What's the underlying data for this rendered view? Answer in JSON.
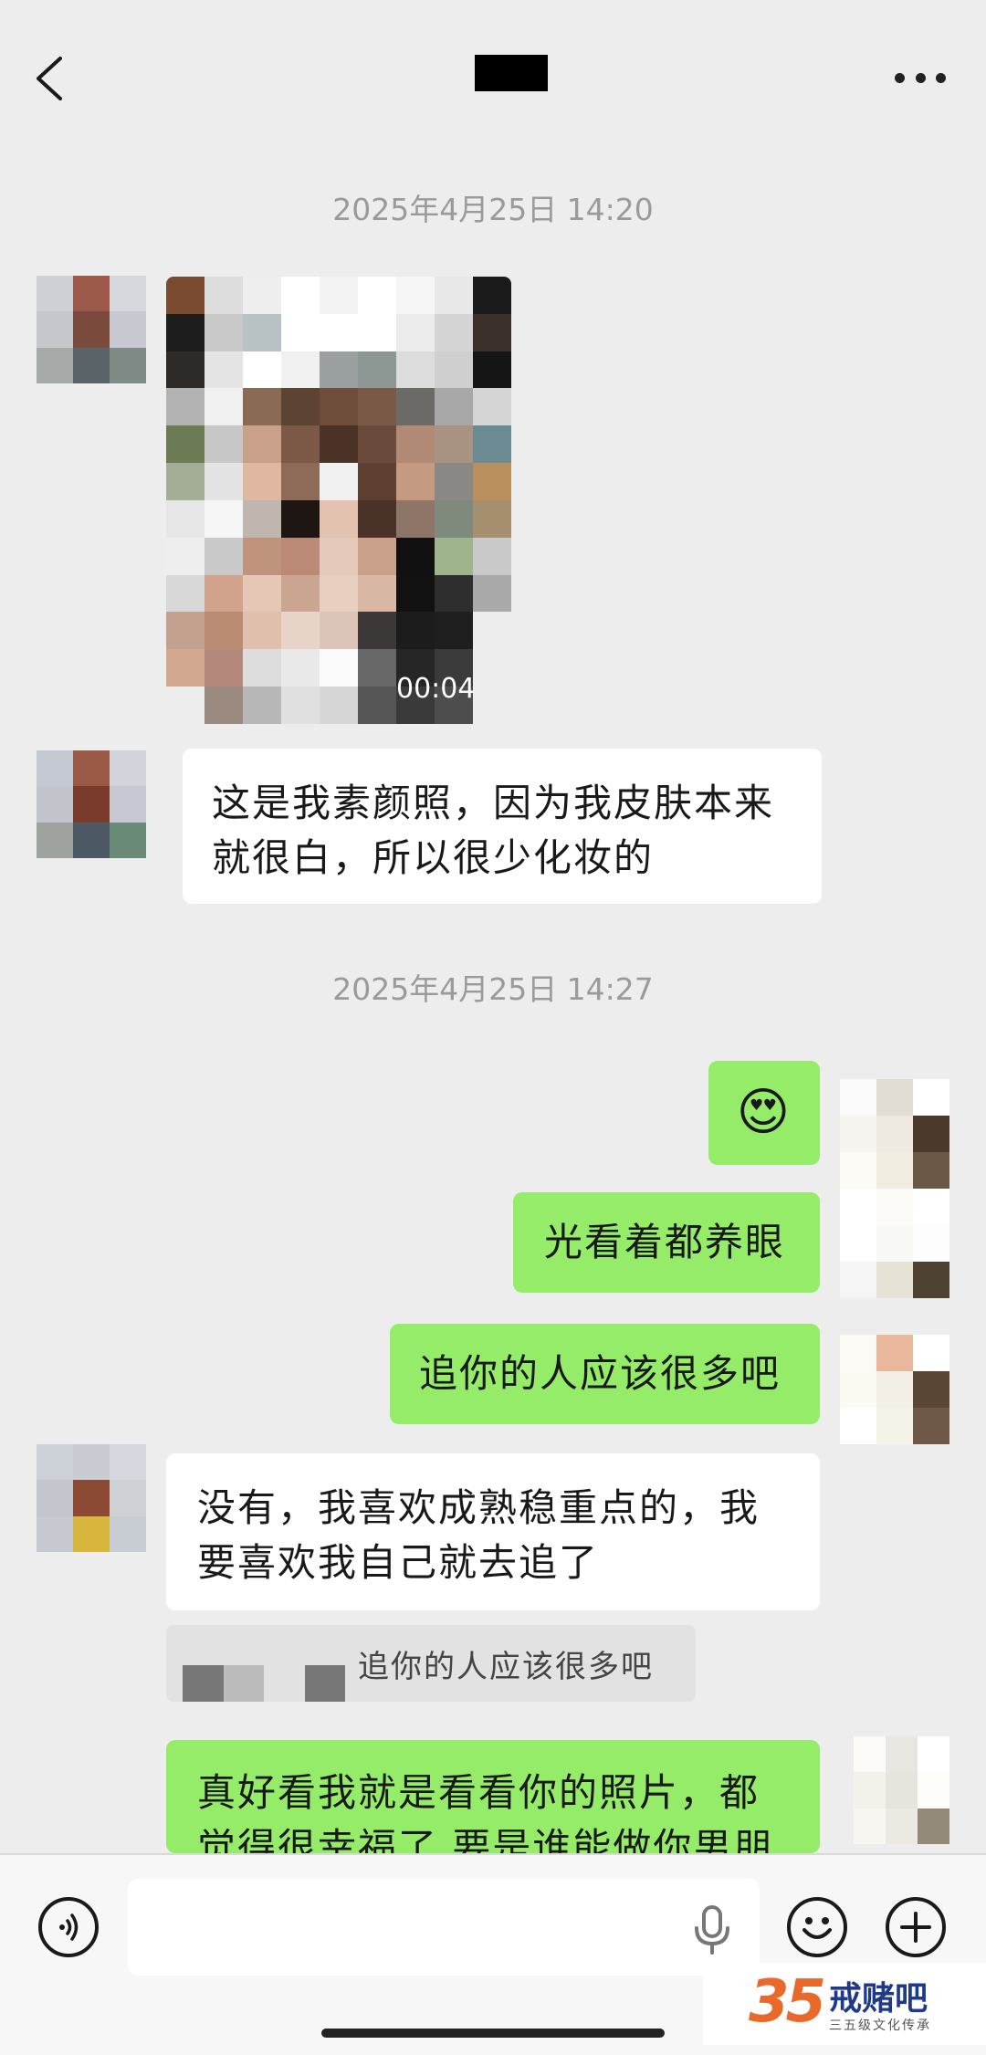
{
  "timestamps": [
    "2025年4月25日 14:20",
    "2025年4月25日 14:27"
  ],
  "video": {
    "duration": "00:04"
  },
  "messages": {
    "m1": {
      "line1": "这是我素颜照，因为我皮肤本来",
      "line2": "就很白，所以很少化妆的"
    },
    "m2": {
      "emoji": "😍"
    },
    "m3": {
      "text": "光看着都养眼"
    },
    "m4": {
      "text": "追你的人应该很多吧"
    },
    "m5": {
      "line1": "没有，我喜欢成熟稳重点的，我",
      "line2": "要喜欢我自己就去追了"
    },
    "m5_quote": "追你的人应该很多吧",
    "m6": {
      "line1": "真好看我就是看看你的照片，都",
      "line2": "觉得很幸福了 要是谁能做你男朋"
    }
  },
  "watermark": {
    "number": "35",
    "brand": "戒赌吧",
    "tagline": "三五级文化传承"
  },
  "icons": [
    "back-arrow-icon",
    "more-icon",
    "voice-icon",
    "microphone-icon",
    "emoji-icon",
    "plus-icon"
  ],
  "colors": {
    "background": "#ededed",
    "sent_bubble": "#95ec69",
    "received_bubble": "#ffffff"
  }
}
